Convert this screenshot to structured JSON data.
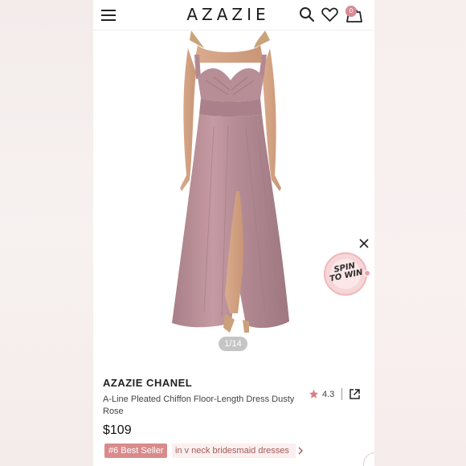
{
  "header": {
    "brand": "AZAZIE",
    "cart_count": "0",
    "icons": [
      "menu-icon",
      "search-icon",
      "heart-icon",
      "shopping-bag-icon"
    ]
  },
  "gallery": {
    "counter": "1/14",
    "dress_color": "#b98e96"
  },
  "promo": {
    "spin_line1": "SPIN",
    "spin_line2": "TO WIN",
    "close_icon": "close-icon"
  },
  "product": {
    "brand_name": "AZAZIE CHANEL",
    "title": "A-Line Pleated Chiffon Floor-Length Dress Dusty Rose",
    "rating": "4.3",
    "price": "$109",
    "bestseller_tag": "#6 Best Seller",
    "bestseller_category": "in v neck bridesmaid dresses"
  },
  "colors": {
    "accent": "#d98b8b",
    "badge": "#d98a93",
    "star": "#d77f8a"
  }
}
